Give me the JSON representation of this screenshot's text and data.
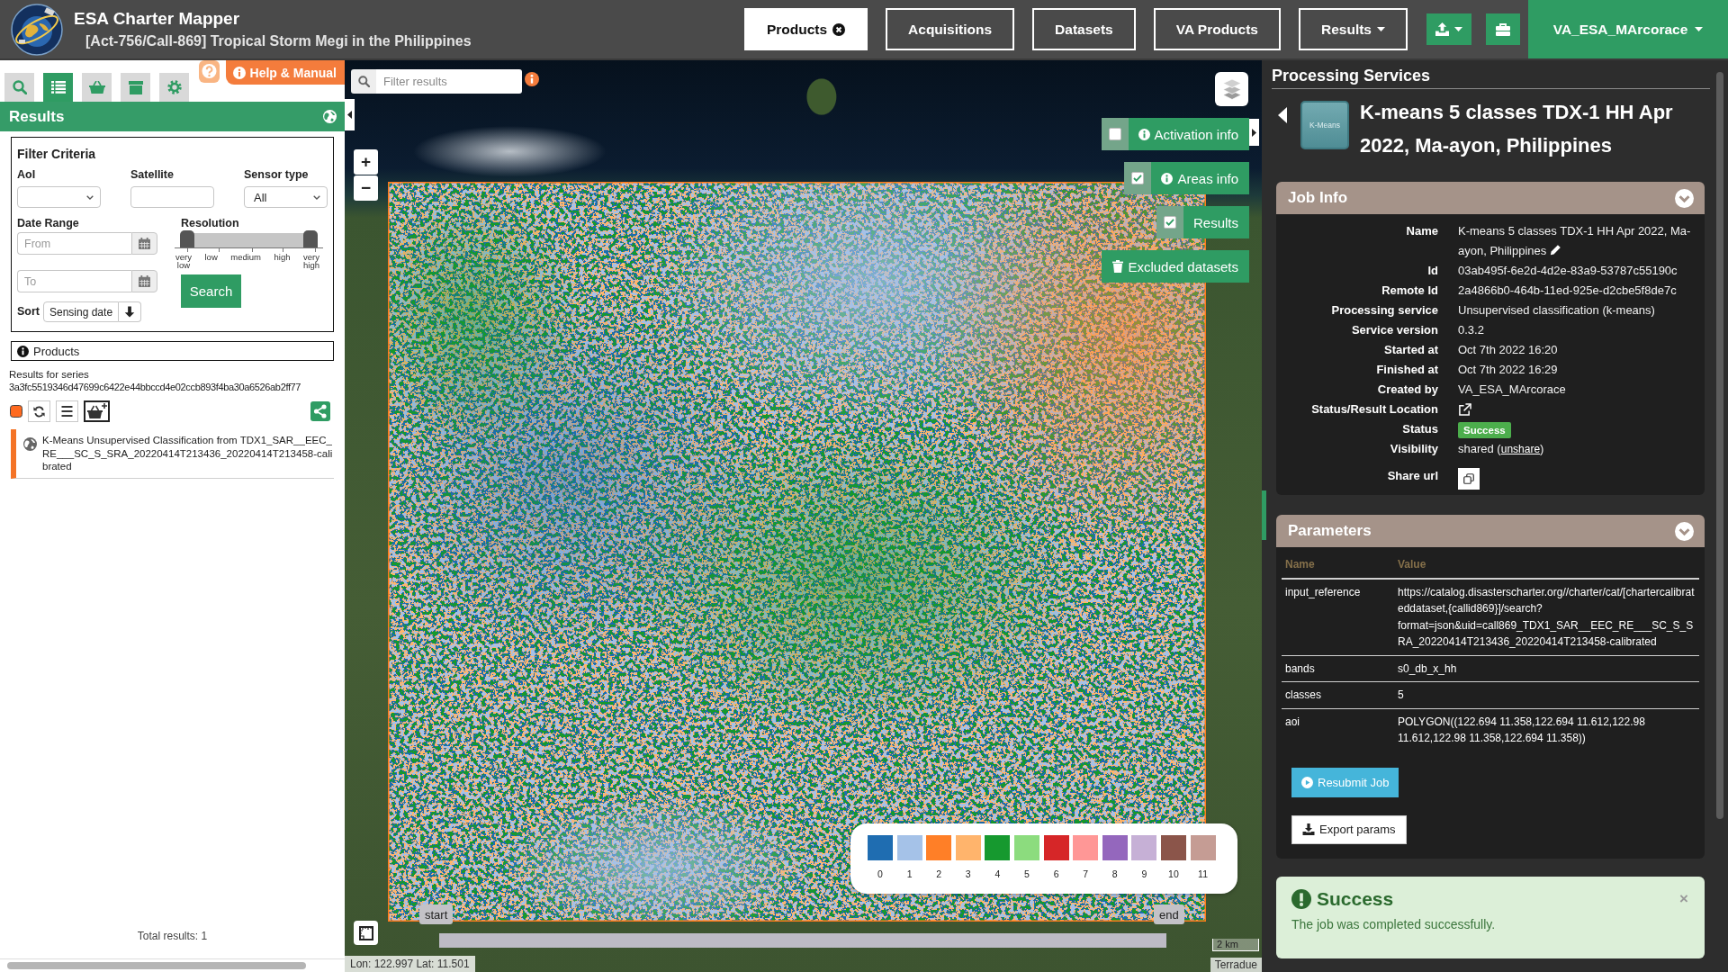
{
  "header": {
    "app_title": "ESA Charter Mapper",
    "subtitle": "[Act-756/Call-869] Tropical Storm Megi in the Philippines",
    "nav": [
      {
        "label": "Products",
        "kind": "closable",
        "selected": true
      },
      {
        "label": "Acquisitions",
        "kind": "plain",
        "selected": false
      },
      {
        "label": "Datasets",
        "kind": "plain",
        "selected": false
      },
      {
        "label": "VA Products",
        "kind": "plain",
        "selected": false
      },
      {
        "label": "Results",
        "kind": "dropdown",
        "selected": false
      }
    ],
    "user": "VA_ESA_MArcorace"
  },
  "sidebar": {
    "tabs": [
      {
        "kind": "search",
        "selected": false
      },
      {
        "kind": "list",
        "selected": true
      },
      {
        "kind": "basket",
        "selected": false
      },
      {
        "kind": "archive",
        "selected": false
      },
      {
        "kind": "settings",
        "selected": false
      }
    ],
    "help_button": "Help & Manual",
    "panel_title": "Results",
    "filter": {
      "title": "Filter Criteria",
      "aoi_label": "AoI",
      "satellite_label": "Satellite",
      "sensor_label": "Sensor type",
      "sensor_value": "All",
      "date_label": "Date Range",
      "from_placeholder": "From",
      "to_placeholder": "To",
      "resolution_label": "Resolution",
      "resolution_min": {
        "level": 0
      },
      "resolution_max": {
        "level": 1
      },
      "resolution_ticks": [
        "very low",
        "low",
        "medium",
        "high",
        "very high"
      ],
      "search_button": "Search",
      "sort_label": "Sort",
      "sort_value": "Sensing date"
    },
    "products_title": "Products",
    "series_label": "Results for series",
    "series_id": "3a3fc5519346d47699c6422e44bbccd4e02ccb893f4ba30a6526ab2ff77",
    "results": [
      {
        "title": "K-Means Unsupervised Classification from TDX1_SAR__EEC_RE___SC_S_SRA_20220414T213436_20220414T213458-calibrated"
      }
    ],
    "total": "Total results: 1"
  },
  "map": {
    "filter_placeholder": "Filter results",
    "zoom_in": "+",
    "zoom_out": "−",
    "toggles": [
      {
        "label": "Activation info",
        "checked": false,
        "kind": "info"
      },
      {
        "label": "Areas info",
        "checked": true,
        "kind": "info"
      },
      {
        "label": "Results",
        "checked": true,
        "kind": "plain"
      }
    ],
    "excluded_button": "Excluded datasets",
    "legend": [
      {
        "label": "0",
        "color": "#1f6db1"
      },
      {
        "label": "1",
        "color": "#a5c2e8"
      },
      {
        "label": "2",
        "color": "#ff7f27"
      },
      {
        "label": "3",
        "color": "#ffb46c"
      },
      {
        "label": "4",
        "color": "#16992f"
      },
      {
        "label": "5",
        "color": "#8cdc7e"
      },
      {
        "label": "6",
        "color": "#d62628"
      },
      {
        "label": "7",
        "color": "#ff9796"
      },
      {
        "label": "8",
        "color": "#9467bd"
      },
      {
        "label": "9",
        "color": "#c6b0d6"
      },
      {
        "label": "10",
        "color": "#8b554a"
      },
      {
        "label": "11",
        "color": "#c59c94"
      }
    ],
    "time_start": "start",
    "time_end": "end",
    "scale": "2 km",
    "attribution": "Terradue",
    "coordinates": "Lon: 122.997 Lat: 11.501"
  },
  "processing": {
    "title": "Processing Services",
    "service_tile": "K-Means",
    "job_title": "K-means 5 classes TDX-1 HH Apr 2022, Ma-ayon, Philippines",
    "job_info": {
      "title": "Job Info",
      "rows": [
        {
          "label": "Name",
          "kind": "editable",
          "value": "K-means 5 classes TDX-1 HH Apr 2022, Ma-ayon, Philippines"
        },
        {
          "label": "Id",
          "kind": "text",
          "value": "03ab495f-6e2d-4d2e-83a9-53787c55190c"
        },
        {
          "label": "Remote Id",
          "kind": "text",
          "value": "2a4866b0-464b-11ed-925e-d2cbe5f8de7c"
        },
        {
          "label": "Processing service",
          "kind": "text",
          "value": "Unsupervised classification (k-means)"
        },
        {
          "label": "Service version",
          "kind": "text",
          "value": "0.3.2"
        },
        {
          "label": "Started at",
          "kind": "text",
          "value": "Oct 7th 2022 16:20"
        },
        {
          "label": "Finished at",
          "kind": "text",
          "value": "Oct 7th 2022 16:29"
        },
        {
          "label": "Created by",
          "kind": "text",
          "value": "VA_ESA_MArcorace"
        },
        {
          "label": "Status/Result Location",
          "kind": "link"
        },
        {
          "label": "Status",
          "kind": "badge",
          "value": "Success"
        },
        {
          "label": "Visibility",
          "kind": "visibility",
          "text_before": "shared (",
          "link": "unshare",
          "text_after": ")"
        },
        {
          "label": "Share url",
          "kind": "copy"
        }
      ]
    },
    "parameters": {
      "title": "Parameters",
      "columns": [
        "Name",
        "Value"
      ],
      "rows": [
        {
          "name": "input_reference",
          "value": "https://catalog.disasterscharter.org//charter/cat/[chartercalibrateddataset,{callid869}]/search?format=json&uid=call869_TDX1_SAR__EEC_RE___SC_S_SRA_20220414T213436_20220414T213458-calibrated"
        },
        {
          "name": "bands",
          "value": "s0_db_x_hh"
        },
        {
          "name": "classes",
          "value": "5"
        },
        {
          "name": "aoi",
          "value": "POLYGON((122.694 11.358,122.694 11.612,122.98 11.612,122.98 11.358,122.694 11.358))"
        }
      ]
    },
    "buttons": [
      {
        "label": "Resubmit Job",
        "kind": "primary"
      },
      {
        "label": "Export params",
        "kind": "secondary"
      }
    ],
    "alert": {
      "title": "Success",
      "message": "The job was completed successfully.",
      "close": "×"
    }
  }
}
